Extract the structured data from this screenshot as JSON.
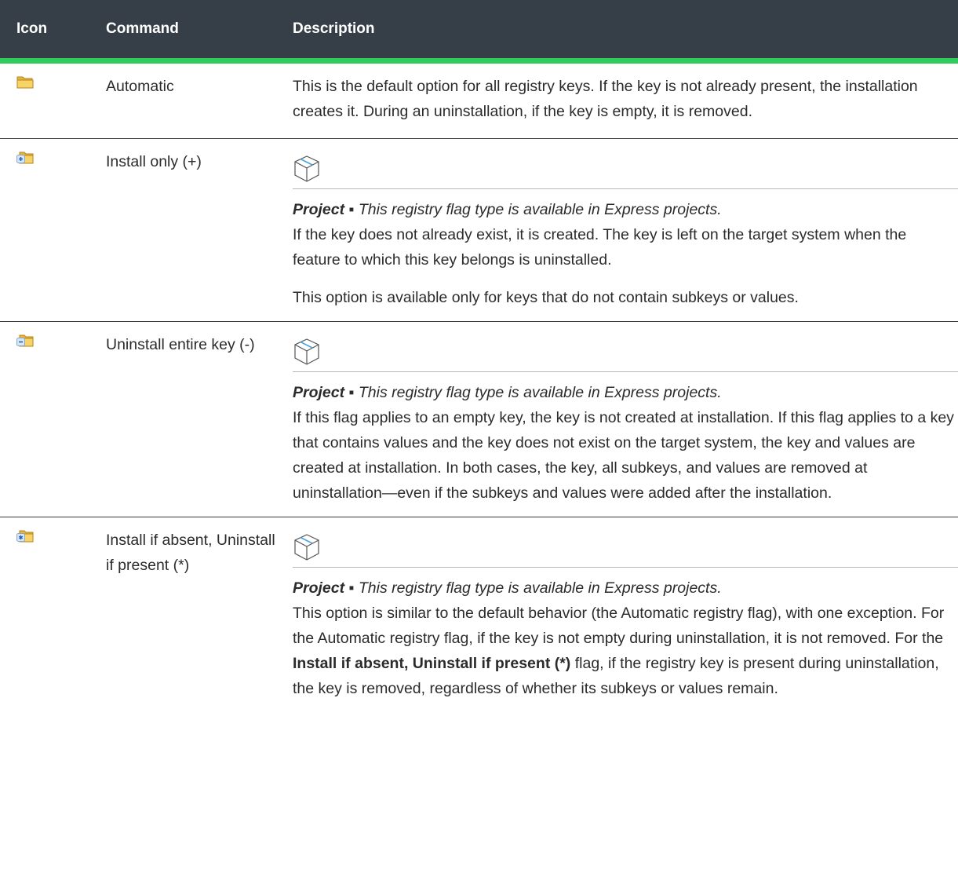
{
  "headers": {
    "icon": "Icon",
    "command": "Command",
    "description": "Description"
  },
  "rows": [
    {
      "icon": "folder-icon",
      "command": "Automatic",
      "description": "This is the default option for all registry keys. If the key is not already present, the installation creates it. During an uninstallation, if the key is empty, it is removed."
    },
    {
      "icon": "folder-plus-icon",
      "command": "Install only (+)",
      "note_label": "Project",
      "note_bullet": " ▪ ",
      "note_text": "This registry flag type is available in Express projects.",
      "paragraphs": [
        "If the key does not already exist, it is created. The key is left on the target system when the feature to which this key belongs is uninstalled.",
        "This option is available only for keys that do not contain subkeys or values."
      ]
    },
    {
      "icon": "folder-minus-icon",
      "command": "Uninstall entire key (-)",
      "note_label": "Project",
      "note_bullet": " ▪ ",
      "note_text": "This registry flag type is available in Express projects.",
      "paragraphs": [
        "If this flag applies to an empty key, the key is not created at installation. If this flag applies to a key that contains values and the key does not exist on the target system, the key and values are created at installation. In both cases, the key, all subkeys, and values are removed at uninstallation—even if the subkeys and values were added after the installation."
      ]
    },
    {
      "icon": "folder-asterisk-icon",
      "command": "Install if absent, Uninstall if present (*)",
      "note_label": "Project",
      "note_bullet": " ▪ ",
      "note_text": "This registry flag type is available in Express projects.",
      "paragraphs": [
        "This option is similar to the default behavior (the Automatic registry flag), with one exception. For the Automatic registry flag, if the key is not empty during uninstallation, it is not removed. For the"
      ],
      "para_bold": "Install if absent, Uninstall if present (*)",
      "para_tail": " flag, if the registry key is present during uninstallation, the key is removed, regardless of whether its subkeys or values remain."
    }
  ]
}
